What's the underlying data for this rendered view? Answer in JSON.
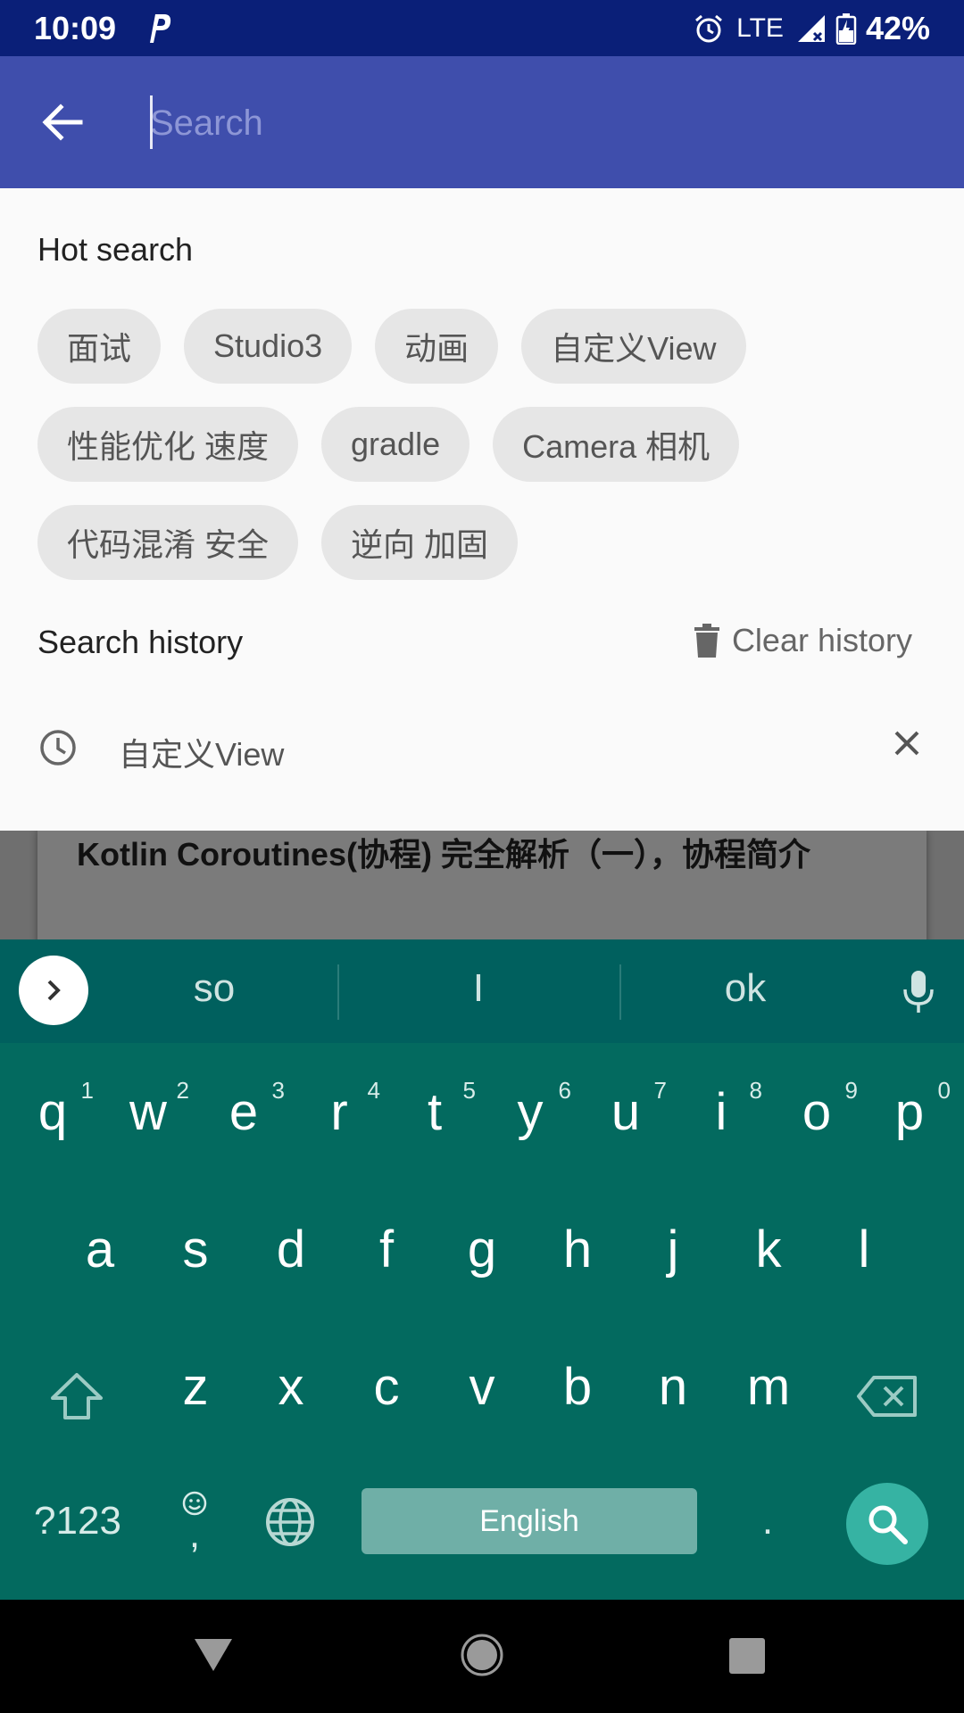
{
  "status_bar": {
    "time": "10:09",
    "network": "LTE",
    "battery": "42%",
    "icons": [
      "parking-notification-icon",
      "alarm-icon",
      "signal-icon",
      "battery-icon"
    ]
  },
  "toolbar": {
    "search_placeholder": "Search",
    "search_value": ""
  },
  "hot_search": {
    "title": "Hot search",
    "rows": [
      [
        "面试",
        "Studio3",
        "动画",
        "自定义View"
      ],
      [
        "性能优化 速度",
        "gradle",
        "Camera 相机"
      ],
      [
        "代码混淆 安全",
        "逆向 加固"
      ]
    ]
  },
  "search_history": {
    "title": "Search history",
    "clear_label": "Clear history",
    "items": [
      "自定义View"
    ]
  },
  "background_card": {
    "title": "Kotlin Coroutines(协程) 完全解析（一），协程简介"
  },
  "keyboard": {
    "suggestions": [
      "so",
      "I",
      "ok"
    ],
    "row1": [
      {
        "key": "q",
        "hint": "1"
      },
      {
        "key": "w",
        "hint": "2"
      },
      {
        "key": "e",
        "hint": "3"
      },
      {
        "key": "r",
        "hint": "4"
      },
      {
        "key": "t",
        "hint": "5"
      },
      {
        "key": "y",
        "hint": "6"
      },
      {
        "key": "u",
        "hint": "7"
      },
      {
        "key": "i",
        "hint": "8"
      },
      {
        "key": "o",
        "hint": "9"
      },
      {
        "key": "p",
        "hint": "0"
      }
    ],
    "row2": [
      "a",
      "s",
      "d",
      "f",
      "g",
      "h",
      "j",
      "k",
      "l"
    ],
    "row3": [
      "z",
      "x",
      "c",
      "v",
      "b",
      "n",
      "m"
    ],
    "symbols_label": "?123",
    "comma_label": ",",
    "space_label": "English",
    "period_label": ".",
    "colors": {
      "background": "#036a5f",
      "suggest_bar": "#00605e",
      "space": "#6fafa7",
      "action": "#36b3a3"
    }
  },
  "colors": {
    "status_bar": "#0a1f78",
    "toolbar": "#3f4eac",
    "panel": "#fafafa",
    "chip": "#e6e6e6"
  }
}
